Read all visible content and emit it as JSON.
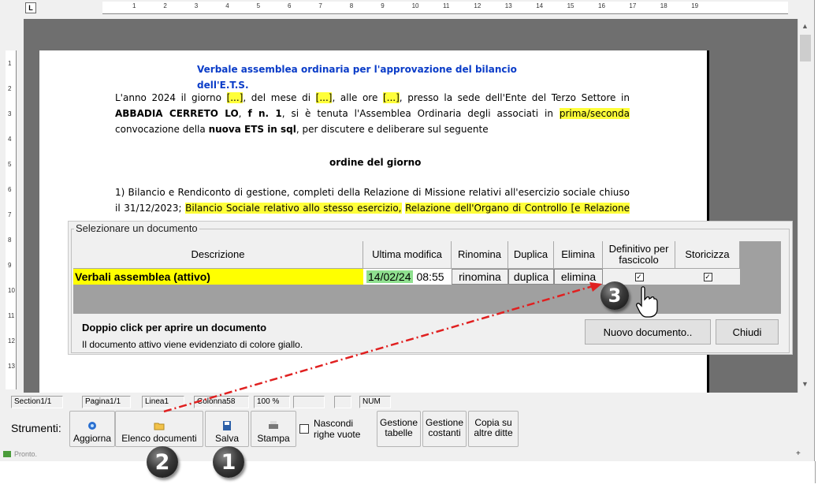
{
  "rulers": {
    "corner": "L",
    "horizontal_marks": [
      "1",
      "2",
      "3",
      "4",
      "5",
      "6",
      "7",
      "8",
      "9",
      "10",
      "11",
      "12",
      "13",
      "14",
      "15",
      "16",
      "17",
      "18",
      "19"
    ],
    "vertical_marks": [
      "1",
      "2",
      "3",
      "4",
      "5",
      "6",
      "7",
      "8",
      "9",
      "10",
      "11",
      "12",
      "13"
    ]
  },
  "document": {
    "title": "Verbale assemblea ordinaria per l'approvazione del bilancio dell'E.T.S.",
    "p1": {
      "a": "L'anno 2024  il giorno ",
      "b": "[...]",
      "c": ", del mese di ",
      "d": "[...]",
      "e": ", alle ore ",
      "f": "[...]",
      "g": ", presso la sede dell'Ente del Terzo Settore in ",
      "h": "ABBADIA CERRETO LO",
      "i": ", ",
      "j": "f n. 1",
      "k": ", si è tenuta l'Assemblea Ordinaria degli associati in ",
      "l": "prima/seconda",
      "m": " convocazione della ",
      "n": "nuova ETS in sql",
      "o": ", per discutere e deliberare sul seguente"
    },
    "heading": "ordine del giorno",
    "p2": {
      "a": "1)  Bilancio e Rendiconto di gestione, completi della Relazione di Missione relativi all'esercizio sociale chiuso il 31/12/2023; ",
      "b": "Bilancio Sociale relativo allo stesso esercizio,",
      "c": " ",
      "d": "Relazione dell'Organo di Controllo [e Relazione del"
    }
  },
  "dialog": {
    "legend": "Selezionare un documento",
    "columns": [
      "Descrizione",
      "Ultima modifica",
      "Rinomina",
      "Duplica",
      "Elimina",
      "Definitivo per fascicolo",
      "Storicizza"
    ],
    "row": {
      "descrizione": "Verbali assemblea (attivo)",
      "data": "14/02/24",
      "ora": "08:55",
      "rinomina": "rinomina",
      "duplica": "duplica",
      "elimina": "elimina",
      "definitivo": "✓",
      "storicizza": "✓"
    },
    "note_bold": "Doppio click per aprire un documento",
    "note": "Il documento attivo viene evidenziato di colore giallo.",
    "new_button": "Nuovo documento..",
    "close_button": "Chiudi"
  },
  "status_bar": {
    "section": "Section1/1",
    "page": "Pagina1/1",
    "line": "Linea1",
    "column": "Colonna58",
    "zoom": "100 %",
    "num": "NUM"
  },
  "toolbar": {
    "label": "Strumenti:",
    "aggiorna": "Aggiorna",
    "elenco": "Elenco documenti",
    "salva": "Salva",
    "stampa": "Stampa",
    "nascondi": "Nascondi righe vuote",
    "gestione_tabelle": "Gestione tabelle",
    "gestione_costanti": "Gestione costanti",
    "copia": "Copia su altre ditte"
  },
  "status_text": "Pronto.",
  "markers": [
    "1",
    "2",
    "3"
  ],
  "colors": {
    "highlight": "#ffff3a",
    "active_row": "#ffff00",
    "date_cell": "#8fe08f",
    "title_blue": "#0a3cc8",
    "arrow_red": "#e02020"
  }
}
